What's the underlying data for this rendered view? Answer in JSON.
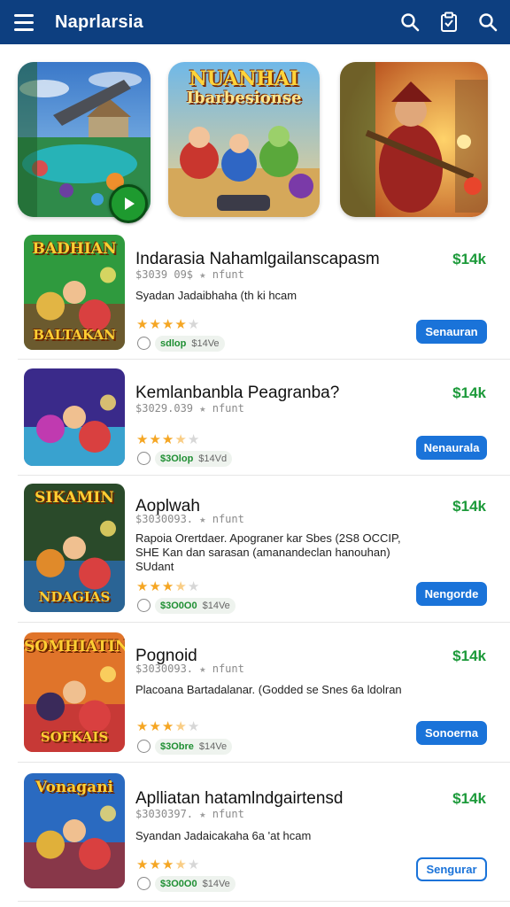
{
  "header": {
    "title": "Naprlarsia",
    "bg_color": "#0d3f80"
  },
  "featured": {
    "center_title": "NUANHAI",
    "center_subtitle": "Ibarbesionse"
  },
  "items": [
    {
      "thumb_title": "BADHIAN",
      "thumb_subtitle": "BALTAKAN",
      "title": "Indarasia Nahamlgailanscapasm",
      "price": "$14k",
      "meta": "$3039 09$",
      "meta_extra": "nfunt",
      "desc": "Syadan Jadaibhaha (th ki hcam",
      "desc2": "",
      "rating": 4,
      "chip_green": "sdlop",
      "chip_text": "$14Ve",
      "button": "Senauran",
      "button_style": "filled"
    },
    {
      "thumb_title": "",
      "thumb_subtitle": "",
      "title": "Kemlanbanbla Peagranba?",
      "price": "$14k",
      "meta": "$3029.039",
      "meta_extra": "nfunt",
      "desc": "",
      "desc2": "",
      "rating": 3.5,
      "chip_green": "$3Olop",
      "chip_text": "$14Vd",
      "button": "Nenaurala",
      "button_style": "filled"
    },
    {
      "thumb_title": "SIKAMIN",
      "thumb_subtitle": "NDAGIAS",
      "title": "Aoplwah",
      "price": "$14k",
      "meta": "$3030093.",
      "meta_extra": "nfunt",
      "desc": "Rapoia Orertdaer. Apograner kar Sbes (2S8 OCCIP,",
      "desc2": "SHE Kan dan sarasan (amanandeclan hanouhan)",
      "desc3": "SUdant",
      "rating": 3.5,
      "chip_green": "$3O0O0",
      "chip_text": "$14Ve",
      "button": "Nengorde",
      "button_style": "filled"
    },
    {
      "thumb_title": "SOMHIATIN",
      "thumb_subtitle": "SOFKAIS",
      "title": "Pognoid",
      "price": "$14k",
      "meta": "$3030093.",
      "meta_extra": "nfunt",
      "desc": "Placoana Bartadalanar. (Godded se Snes 6a ldolran",
      "desc2": "",
      "rating": 3.5,
      "chip_green": "$3Obre",
      "chip_text": "$14Ve",
      "button": "Sonoerna",
      "button_style": "filled"
    },
    {
      "thumb_title": "Vonagani",
      "thumb_subtitle": "",
      "title": "Aplliatan hatamlndgairtensd",
      "price": "$14k",
      "meta": "$3030397.",
      "meta_extra": "nfunt",
      "desc": "Syandan Jadaicakaha 6a 'at hcam",
      "desc2": "",
      "rating": 3.5,
      "chip_green": "$3O0O0",
      "chip_text": "$14Ve",
      "button": "Sengurar",
      "button_style": "outline"
    }
  ]
}
